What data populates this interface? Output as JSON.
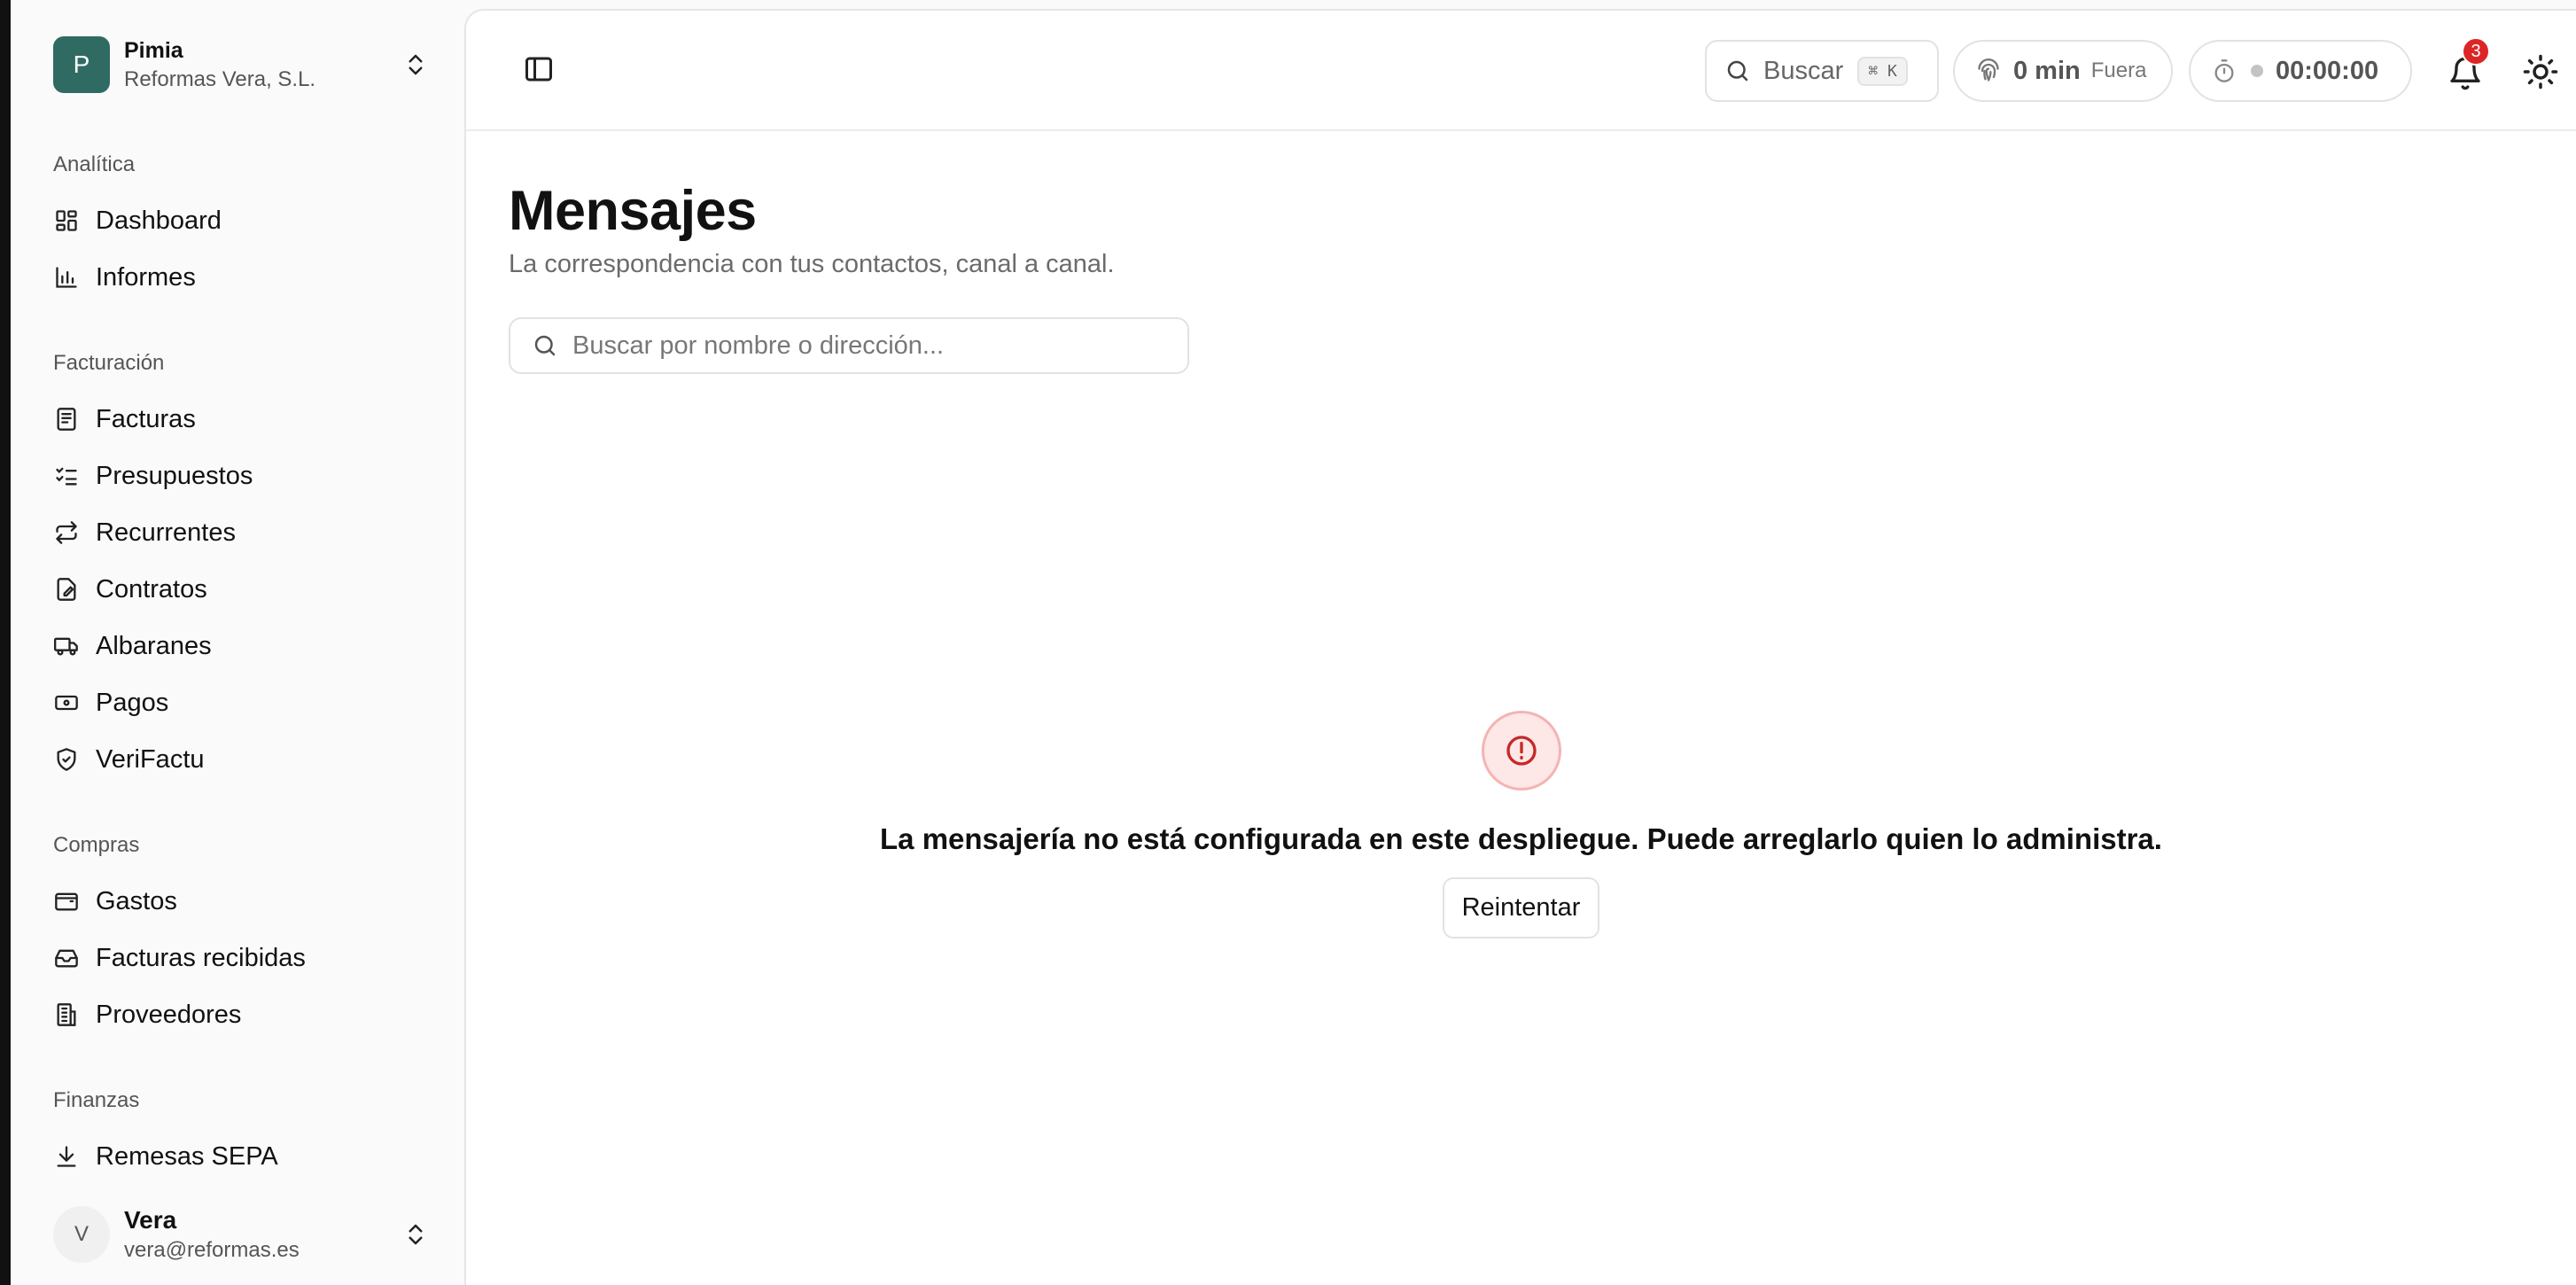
{
  "org": {
    "initial": "P",
    "name": "Pimia",
    "company": "Reformas Vera, S.L."
  },
  "sections": {
    "analitica": "Analítica",
    "facturacion": "Facturación",
    "compras": "Compras",
    "finanzas": "Finanzas"
  },
  "nav": {
    "dashboard": "Dashboard",
    "informes": "Informes",
    "facturas": "Facturas",
    "presupuestos": "Presupuestos",
    "recurrentes": "Recurrentes",
    "contratos": "Contratos",
    "albaranes": "Albaranes",
    "pagos": "Pagos",
    "verifactu": "VeriFactu",
    "gastos": "Gastos",
    "facturas_recibidas": "Facturas recibidas",
    "proveedores": "Proveedores",
    "remesas_sepa": "Remesas SEPA"
  },
  "user": {
    "initial": "V",
    "name": "Vera",
    "email": "vera@reformas.es"
  },
  "topbar": {
    "search_label": "Buscar",
    "search_shortcut": "⌘ K",
    "clock_value": "0 min",
    "clock_status": "Fuera",
    "timer_value": "00:00:00",
    "notifications_count": "3"
  },
  "page": {
    "title": "Mensajes",
    "subtitle": "La correspondencia con tus contactos, canal a canal.",
    "search_placeholder": "Buscar por nombre o dirección...",
    "error_message": "La mensajería no está configurada en este despliegue. Puede arreglarlo quien lo administra.",
    "retry_label": "Reintentar"
  },
  "colors": {
    "brand": "#2f6b63",
    "badge": "#dc2626",
    "error_bg": "#fde7e7"
  }
}
